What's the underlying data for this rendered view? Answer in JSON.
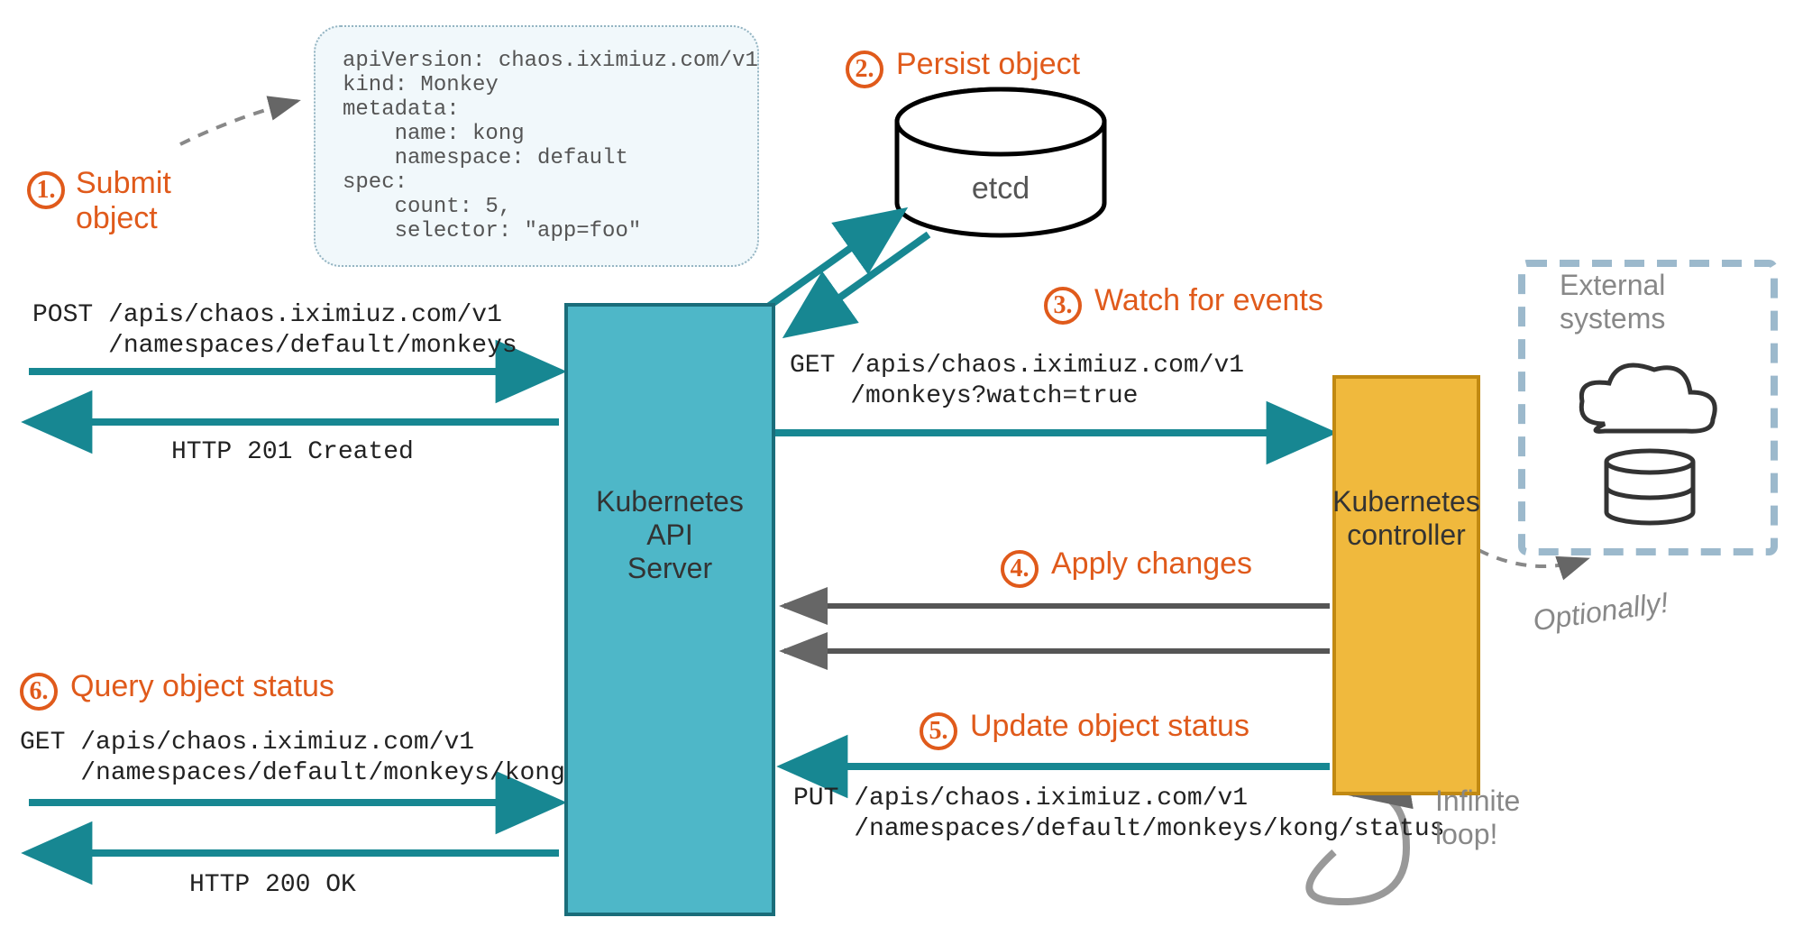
{
  "steps": {
    "s1": {
      "num": "1.",
      "label": "Submit\nobject"
    },
    "s2": {
      "num": "2.",
      "label": "Persist object"
    },
    "s3": {
      "num": "3.",
      "label": "Watch for events"
    },
    "s4": {
      "num": "4.",
      "label": "Apply changes"
    },
    "s5": {
      "num": "5.",
      "label": "Update object status"
    },
    "s6": {
      "num": "6.",
      "label": "Query object status"
    }
  },
  "yaml": "apiVersion: chaos.iximiuz.com/v1\nkind: Monkey\nmetadata:\n    name: kong\n    namespace: default\nspec:\n    count: 5,\n    selector: \"app=foo\"",
  "http": {
    "post_line1": "POST /apis/chaos.iximiuz.com/v1",
    "post_line2": "     /namespaces/default/monkeys",
    "post_resp": "HTTP 201 Created",
    "get_watch_line1": "GET /apis/chaos.iximiuz.com/v1",
    "get_watch_line2": "    /monkeys?watch=true",
    "get_status_line1": "GET /apis/chaos.iximiuz.com/v1",
    "get_status_line2": "    /namespaces/default/monkeys/kong",
    "get_status_resp": "HTTP 200 OK",
    "put_line1": "PUT /apis/chaos.iximiuz.com/v1",
    "put_line2": "    /namespaces/default/monkeys/kong/status"
  },
  "boxes": {
    "api": "Kubernetes\nAPI\nServer",
    "controller": "Kubernetes\ncontroller",
    "etcd": "etcd",
    "external": "External\nsystems"
  },
  "annotations": {
    "optionally": "Optionally!",
    "infinite": "Infinite\nloop!"
  }
}
